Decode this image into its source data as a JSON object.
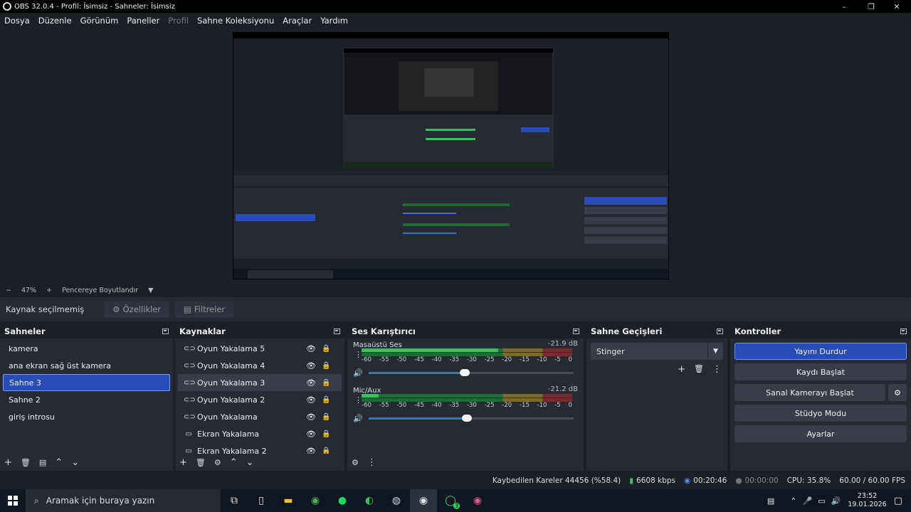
{
  "window": {
    "title": "OBS 32.0.4 - Profil: İsimsiz - Sahneler: İsimsiz",
    "minimize": "–",
    "restore": "❐",
    "close": "✕"
  },
  "menu": {
    "items": [
      "Dosya",
      "Düzenle",
      "Görünüm",
      "Paneller",
      "Profil",
      "Sahne Koleksiyonu",
      "Araçlar",
      "Yardım"
    ]
  },
  "zoom": {
    "minus": "−",
    "value": "47%",
    "plus": "+",
    "fit_label": "Pencereye Boyutlandır",
    "dropdown": "▼"
  },
  "properties_bar": {
    "no_selection": "Kaynak seçilmemiş",
    "properties_label": "Özellikler",
    "filters_label": "Filtreler"
  },
  "scenes": {
    "title": "Sahneler",
    "items": [
      "kamera",
      "ana ekran sağ üst  kamera",
      "Sahne 3",
      "Sahne 2",
      "giriş introsu"
    ],
    "selected_index": 2,
    "footer": [
      "+",
      "🗑",
      "▤",
      "⌃",
      "⌄"
    ]
  },
  "sources": {
    "title": "Kaynaklar",
    "items": [
      {
        "name": "Oyun Yakalama 5",
        "icon": "gamepad-icon"
      },
      {
        "name": "Oyun Yakalama 4",
        "icon": "gamepad-icon"
      },
      {
        "name": "Oyun Yakalama 3",
        "icon": "gamepad-icon"
      },
      {
        "name": "Oyun Yakalama 2",
        "icon": "gamepad-icon"
      },
      {
        "name": "Oyun Yakalama",
        "icon": "gamepad-icon"
      },
      {
        "name": "Ekran Yakalama",
        "icon": "monitor-icon"
      },
      {
        "name": "Ekran Yakalama 2",
        "icon": "monitor-icon"
      }
    ],
    "footer": [
      "+",
      "🗑",
      "⚙",
      "⌃",
      "⌄"
    ]
  },
  "mixer": {
    "title": "Ses Karıştırıcı",
    "channels": [
      {
        "name": "Masaüstü Ses",
        "db": "-21.9 dB",
        "level_fraction": 0.65,
        "volume_fraction": 0.47
      },
      {
        "name": "Mic/Aux",
        "db": "-21.2 dB",
        "level_fraction": 0.08,
        "volume_fraction": 0.48
      }
    ],
    "ticks": [
      "-60",
      "-55",
      "-50",
      "-45",
      "-40",
      "-35",
      "-30",
      "-25",
      "-20",
      "-15",
      "-10",
      "-5",
      "0"
    ],
    "footer": [
      "⚙",
      "⋮"
    ]
  },
  "transitions": {
    "title": "Sahne Geçişleri",
    "selected": "Stinger",
    "buttons": [
      "+",
      "🗑",
      "⋮"
    ]
  },
  "controls": {
    "title": "Kontroller",
    "stop_stream": "Yayını Durdur",
    "start_record": "Kaydı Başlat",
    "start_virtual_cam": "Sanal Kamerayı Başlat",
    "studio_mode": "Stüdyo Modu",
    "settings": "Ayarlar"
  },
  "status": {
    "dropped_frames": "Kaybedilen Kareler 44456 (%58.4)",
    "bitrate": "6608 kbps",
    "stream_time": "00:20:46",
    "record_time": "00:00:00",
    "cpu": "CPU: 35.8%",
    "fps": "60.00 / 60.00 FPS"
  },
  "taskbar": {
    "search_placeholder": "Aramak için buraya yazın",
    "time": "23:52",
    "date": "19.01.2026",
    "whatsapp_badge": "3"
  },
  "colors": {
    "accent": "#284cb8",
    "panel": "#272a33",
    "background": "#1d1f26"
  }
}
